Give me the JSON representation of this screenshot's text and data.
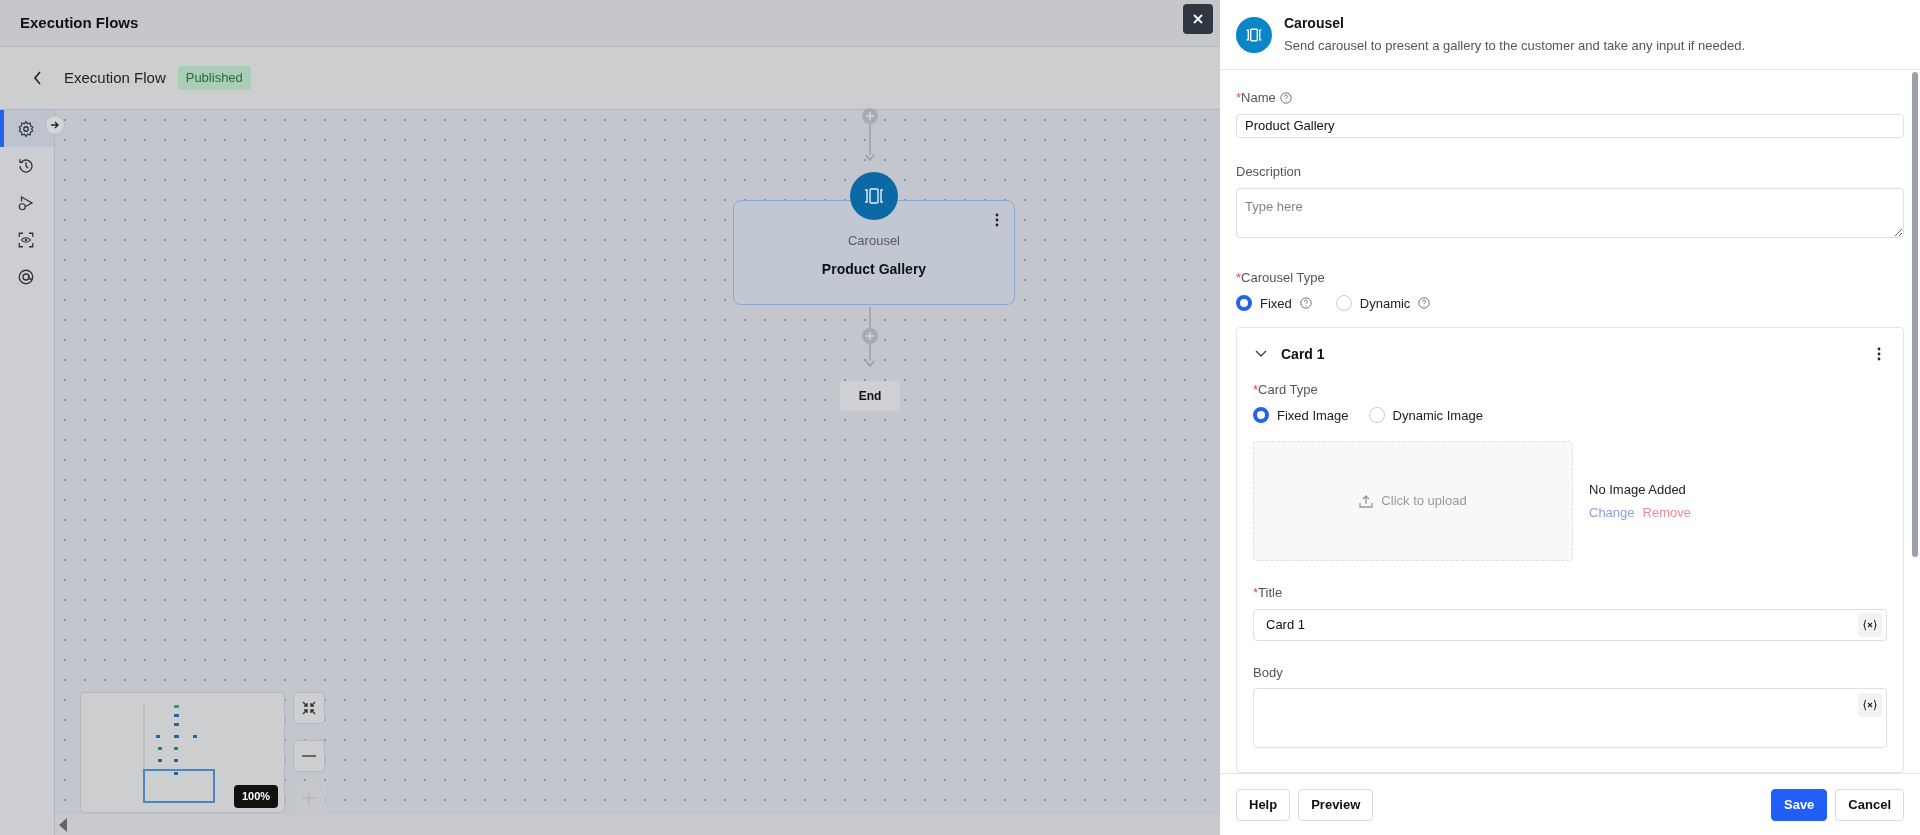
{
  "header": {
    "title": "Execution Flows"
  },
  "flow": {
    "title": "Execution Flow",
    "status": "Published"
  },
  "rail": [
    {
      "kind": "settings",
      "selected": true
    },
    {
      "kind": "history",
      "selected": false
    },
    {
      "kind": "run",
      "selected": false
    },
    {
      "kind": "preview",
      "selected": false
    },
    {
      "kind": "mention",
      "selected": false
    }
  ],
  "canvas": {
    "node": {
      "type": "Carousel",
      "name": "Product Gallery"
    },
    "end": "End",
    "zoom_reading": "100%"
  },
  "panel": {
    "title": "Carousel",
    "subtitle": "Send carousel to present a gallery to the customer and take any input if needed.",
    "name": {
      "mark": "*",
      "label": "Name",
      "value": "Product Gallery"
    },
    "description": {
      "label": "Description",
      "placeholder": "Type here"
    },
    "carousel_type": {
      "mark": "*",
      "label": "Carousel Type",
      "options": [
        {
          "label": "Fixed",
          "selected": true
        },
        {
          "label": "Dynamic",
          "selected": false
        }
      ]
    },
    "card": {
      "title": "Card 1",
      "expanded": true,
      "card_type": {
        "mark": "*",
        "label": "Card Type",
        "options": [
          {
            "label": "Fixed Image",
            "selected": true
          },
          {
            "label": "Dynamic Image",
            "selected": false
          }
        ]
      },
      "upload": "Click to upload",
      "image_status": "No Image Added",
      "change": "Change",
      "remove": "Remove",
      "title_field": {
        "mark": "*",
        "label": "Title",
        "value": "Card 1"
      },
      "body": {
        "label": "Body"
      }
    },
    "footer_left": [
      {
        "label": "Help",
        "kind": "secondary"
      },
      {
        "label": "Preview",
        "kind": "secondary"
      }
    ],
    "footer_right": [
      {
        "label": "Save",
        "kind": "primary"
      },
      {
        "label": "Cancel",
        "kind": "secondary"
      }
    ]
  }
}
